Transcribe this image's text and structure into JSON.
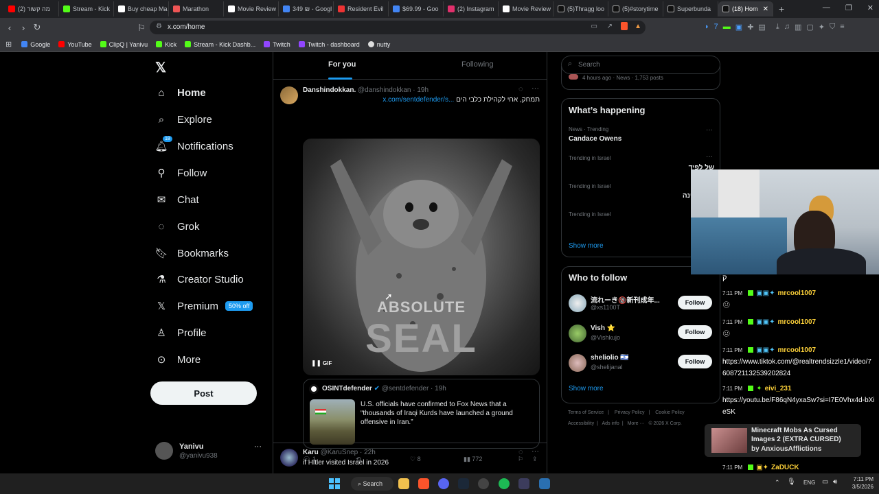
{
  "browser": {
    "tabs": [
      {
        "label": "(2) מה קשור",
        "color": "#ff0000"
      },
      {
        "label": "Stream - Kick",
        "color": "#53fc18"
      },
      {
        "label": "Buy cheap Ma",
        "color": "#ffffff"
      },
      {
        "label": "Marathon",
        "color": "#e55"
      },
      {
        "label": "Movie Review",
        "color": "#ffffff"
      },
      {
        "label": "349 ₪ - Googl",
        "color": "#4285f4"
      },
      {
        "label": "Resident Evil",
        "color": "#e33"
      },
      {
        "label": "$69.99 - Goo",
        "color": "#4285f4"
      },
      {
        "label": "(2) Instagram",
        "color": "#e1306c"
      },
      {
        "label": "Movie Review",
        "color": "#ffffff"
      },
      {
        "label": "(5)Thragg loo",
        "color": "#111"
      },
      {
        "label": "(5)#storytime",
        "color": "#111"
      },
      {
        "label": "Superbunda",
        "color": "#111"
      },
      {
        "label": "(18) Hom",
        "color": "#111"
      }
    ],
    "url": "x.com/home",
    "bookmarks": [
      {
        "label": "Google",
        "color": "#4285f4"
      },
      {
        "label": "YouTube",
        "color": "#ff0000"
      },
      {
        "label": "ClipQ | Yanivu",
        "color": "#53fc18"
      },
      {
        "label": "Kick",
        "color": "#53fc18"
      },
      {
        "label": "Stream - Kick Dashb...",
        "color": "#53fc18"
      },
      {
        "label": "Twitch",
        "color": "#9146ff"
      },
      {
        "label": "Twitch - dashboard",
        "color": "#9146ff"
      },
      {
        "label": "nutty",
        "color": "#ddd"
      }
    ]
  },
  "nav": {
    "items": [
      {
        "label": "Home",
        "icon": "home-icon"
      },
      {
        "label": "Explore",
        "icon": "search-icon"
      },
      {
        "label": "Notifications",
        "icon": "bell-icon",
        "badge": "18"
      },
      {
        "label": "Follow",
        "icon": "add-person-icon"
      },
      {
        "label": "Chat",
        "icon": "mail-icon"
      },
      {
        "label": "Grok",
        "icon": "grok-icon"
      },
      {
        "label": "Bookmarks",
        "icon": "bookmark-icon"
      },
      {
        "label": "Creator Studio",
        "icon": "flask-icon"
      },
      {
        "label": "Premium",
        "icon": "x-icon",
        "pill": "50% off"
      },
      {
        "label": "Profile",
        "icon": "person-icon"
      },
      {
        "label": "More",
        "icon": "more-circle-icon"
      }
    ],
    "post_label": "Post",
    "account": {
      "name": "Yanivu",
      "handle": "@yanivu938"
    }
  },
  "feed": {
    "tabs": [
      "For you",
      "Following"
    ],
    "post1": {
      "name": "Danshindokkan.",
      "handle": "@danshindokkan",
      "time": "· 19h",
      "text": "תמחק, אחי לקהילת כלבי הים",
      "link": "x.com/sentdefender/s...",
      "gif_line1": "ABSOLUTE",
      "gif_line2": "SEAL",
      "gif_label": "GIF",
      "quote": {
        "name": "OSINTdefender",
        "handle": "@sentdefender · 19h",
        "text": "U.S. officials have confirmed to Fox News that a “thousands of Iraqi Kurds have launched a ground offensive in Iran.”"
      },
      "replies": "1",
      "likes": "8",
      "views": "772"
    },
    "post2": {
      "name": "Karu",
      "handle": "@KaruSnep · 22h",
      "text": "if Hitler visited Israel in 2026"
    }
  },
  "sidebar": {
    "search_placeholder": "Search",
    "top_meta": "4 hours ago · News · 1,753 posts",
    "happening_title": "What’s happening",
    "trends": [
      {
        "meta": "News · Trending",
        "title": "Candace Owens"
      },
      {
        "meta": "Trending in Israel",
        "title": "של לפיד"
      },
      {
        "meta": "Trending in Israel",
        "title": "ינה"
      },
      {
        "meta": "Trending in Israel",
        "title": ""
      }
    ],
    "show_more": "Show more",
    "who_title": "Who to follow",
    "who": [
      {
        "name": "流れーき🔞新刊成年...",
        "handle": "@xs1100T"
      },
      {
        "name": "Vish ⭐",
        "handle": "@Vishkujo"
      },
      {
        "name": "sheliolio 🇮🇱",
        "handle": "@shelijanal"
      }
    ],
    "follow_label": "Follow",
    "footer1": [
      "Terms of Service",
      "Privacy Policy",
      "Cookie Policy"
    ],
    "footer2": [
      "Accessibility",
      "Ads info",
      "More ···",
      "© 2026 X Corp."
    ]
  },
  "overlay": {
    "chat": [
      {
        "time": "7:11 PM",
        "user": "mrcool1007",
        "text": ""
      },
      {
        "time": "7:11 PM",
        "user": "mrcool1007",
        "text": ""
      },
      {
        "time": "7:11 PM",
        "user": "mrcool1007",
        "text": "https://www.tiktok.com/@realtrendsizzle1/video/7608721132539202824"
      },
      {
        "time": "7:11 PM",
        "user": "eivi_231",
        "text": "https://youtu.be/F86qN4yxaSw?si=I7E0Vhx4d-bXieSK"
      },
      {
        "time": "7:11 PM",
        "user": "ZaDUCK",
        "text": ""
      }
    ],
    "chat_char": "ק",
    "notif_title": "Minecraft Mobs As Cursed Images 2 (EXTRA CURSED)",
    "notif_by": "by AnxiousAfflictions"
  },
  "taskbar": {
    "search": "Search",
    "lang": "ENG",
    "time": "7:11 PM",
    "date": "3/5/2026"
  }
}
